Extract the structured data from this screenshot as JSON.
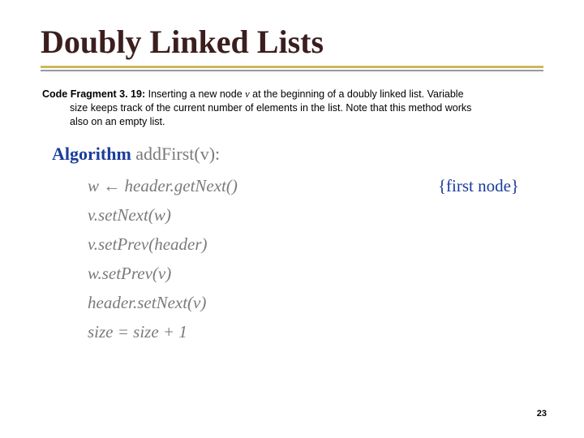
{
  "title": "Doubly Linked Lists",
  "caption": {
    "label": "Code Fragment 3. 19:",
    "text1": " Inserting a new node ",
    "var": "v",
    "text2": " at the beginning of a doubly linked list. Variable",
    "line2": "size keeps track of the current number of elements in the list. Note that this method works",
    "line3": "also on an empty list."
  },
  "algo": {
    "keyword": "Algorithm",
    "signature": " addFirst(v):",
    "lines": [
      {
        "text": "w ← header.getNext()",
        "comment": "{first node}"
      },
      {
        "text": "v.setNext(w)"
      },
      {
        "text": "v.setPrev(header)"
      },
      {
        "text": "w.setPrev(v)"
      },
      {
        "text": "header.setNext(v)"
      },
      {
        "text": "size = size + 1"
      }
    ]
  },
  "pagenum": "23"
}
